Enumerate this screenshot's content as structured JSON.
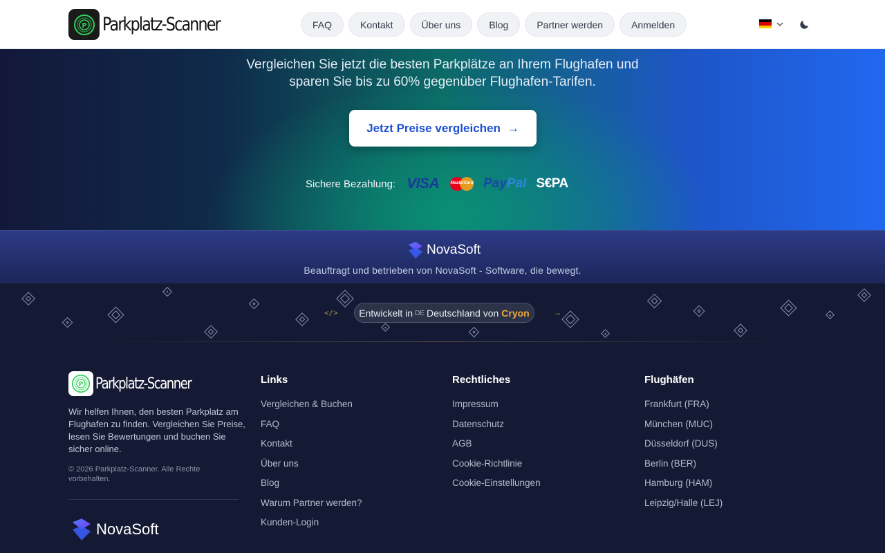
{
  "header": {
    "brand": "Parkplatz-Scanner",
    "nav": [
      "FAQ",
      "Kontakt",
      "Über uns",
      "Blog",
      "Partner werden",
      "Anmelden"
    ],
    "language": "DE"
  },
  "hero": {
    "subtitle_line1": "Vergleichen Sie jetzt die besten Parkplätze an Ihrem Flughafen und",
    "subtitle_line2": "sparen Sie bis zu 60% gegenüber Flughafen-Tarifen.",
    "cta_label": "Jetzt Preise vergleichen",
    "cta_arrow": "→",
    "payment_label": "Sichere Bezahlung:",
    "payment_methods": {
      "visa": "VISA",
      "mastercard": "MasterCard",
      "paypal_pay": "Pay",
      "paypal_pal": "Pal",
      "sepa": "S€PA"
    }
  },
  "operator": {
    "name": "NovaSoft",
    "tagline": "Beauftragt und betrieben von NovaSoft - Software, die bewegt."
  },
  "credit": {
    "code_symbol": "</>",
    "prefix": "Entwickelt in",
    "country_code": "DE",
    "country": "Deutschland von",
    "developer": "Cryon",
    "arrow": "→"
  },
  "footer": {
    "brand": "Parkplatz-Scanner",
    "description": "Wir helfen Ihnen, den besten Parkplatz am Flughafen zu finden. Vergleichen Sie Preise, lesen Sie Bewertungen und buchen Sie sicher online.",
    "copyright": "© 2026 Parkplatz-Scanner. Alle Rechte vorbehalten.",
    "operator_logo": "NovaSoft",
    "columns": [
      {
        "title": "Links",
        "items": [
          "Vergleichen & Buchen",
          "FAQ",
          "Kontakt",
          "Über uns",
          "Blog",
          "Warum Partner werden?",
          "Kunden-Login"
        ]
      },
      {
        "title": "Rechtliches",
        "items": [
          "Impressum",
          "Datenschutz",
          "AGB",
          "Cookie-Richtlinie",
          "Cookie-Einstellungen"
        ]
      },
      {
        "title": "Flughäfen",
        "items": [
          "Frankfurt (FRA)",
          "München (MUC)",
          "Düsseldorf (DUS)",
          "Berlin (BER)",
          "Hamburg (HAM)",
          "Leipzig/Halle (LEJ)"
        ]
      }
    ]
  },
  "colors": {
    "accent_blue": "#1d4fd3",
    "brand_green": "#2fd35a",
    "cryon_orange": "#f2a93b",
    "footer_bg": "#141a33"
  }
}
